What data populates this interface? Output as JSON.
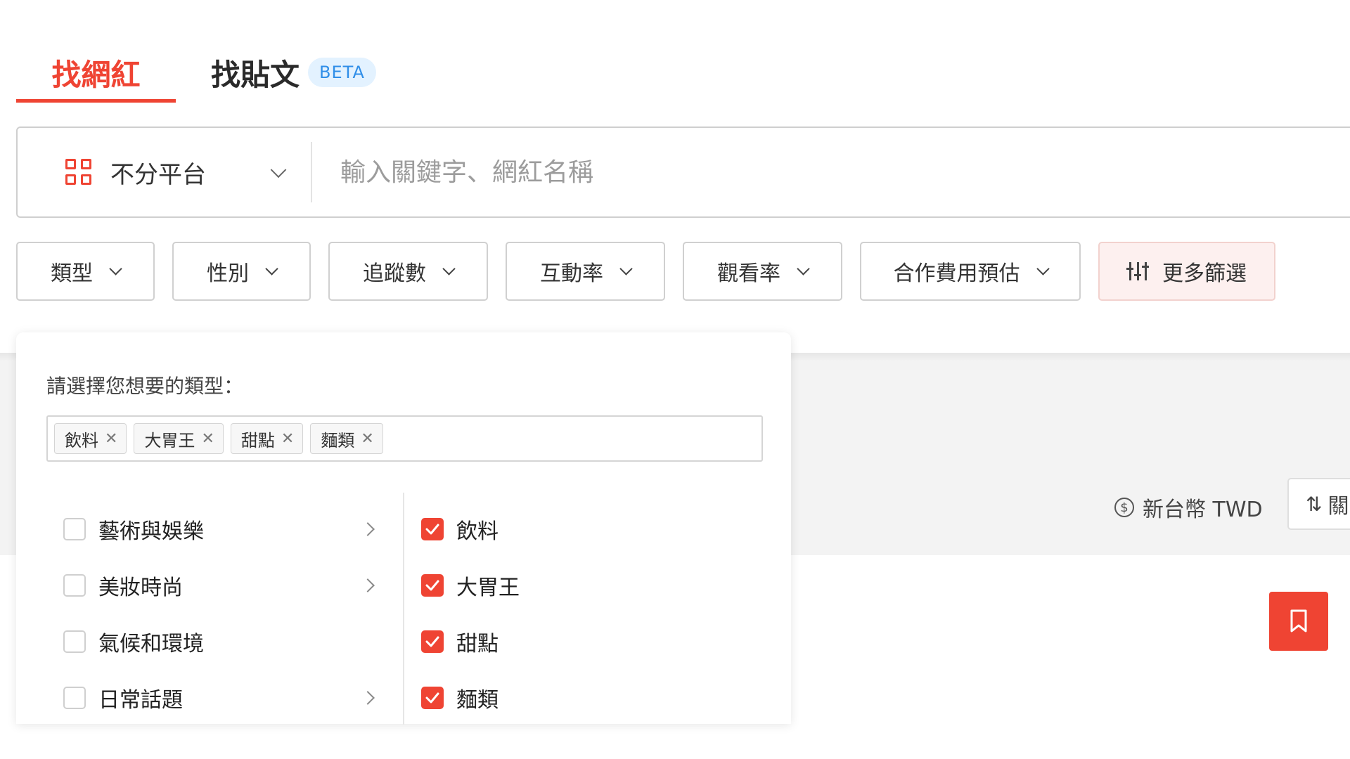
{
  "tabs": {
    "influencers": "找網紅",
    "posts": "找貼文",
    "beta": "BETA"
  },
  "search": {
    "platform": "不分平台",
    "placeholder": "輸入關鍵字、網紅名稱"
  },
  "filters": [
    "類型",
    "性別",
    "追蹤數",
    "互動率",
    "觀看率",
    "合作費用預估"
  ],
  "more_filters": "更多篩選",
  "dropdown": {
    "prompt": "請選擇您想要的類型：",
    "selected_tags": [
      "飲料",
      "大胃王",
      "甜點",
      "麵類"
    ],
    "categories": [
      "藝術與娛樂",
      "美妝時尚",
      "氣候和環境",
      "日常話題"
    ],
    "subcategories": [
      "飲料",
      "大胃王",
      "甜點",
      "麵類"
    ]
  },
  "toolbar": {
    "currency": "新台幣 TWD",
    "currency_symbol": "$",
    "sort_label": "關"
  },
  "colors": {
    "accent": "#ef4433",
    "beta_bg": "#e3f2ff",
    "beta_text": "#2f8ee8"
  }
}
